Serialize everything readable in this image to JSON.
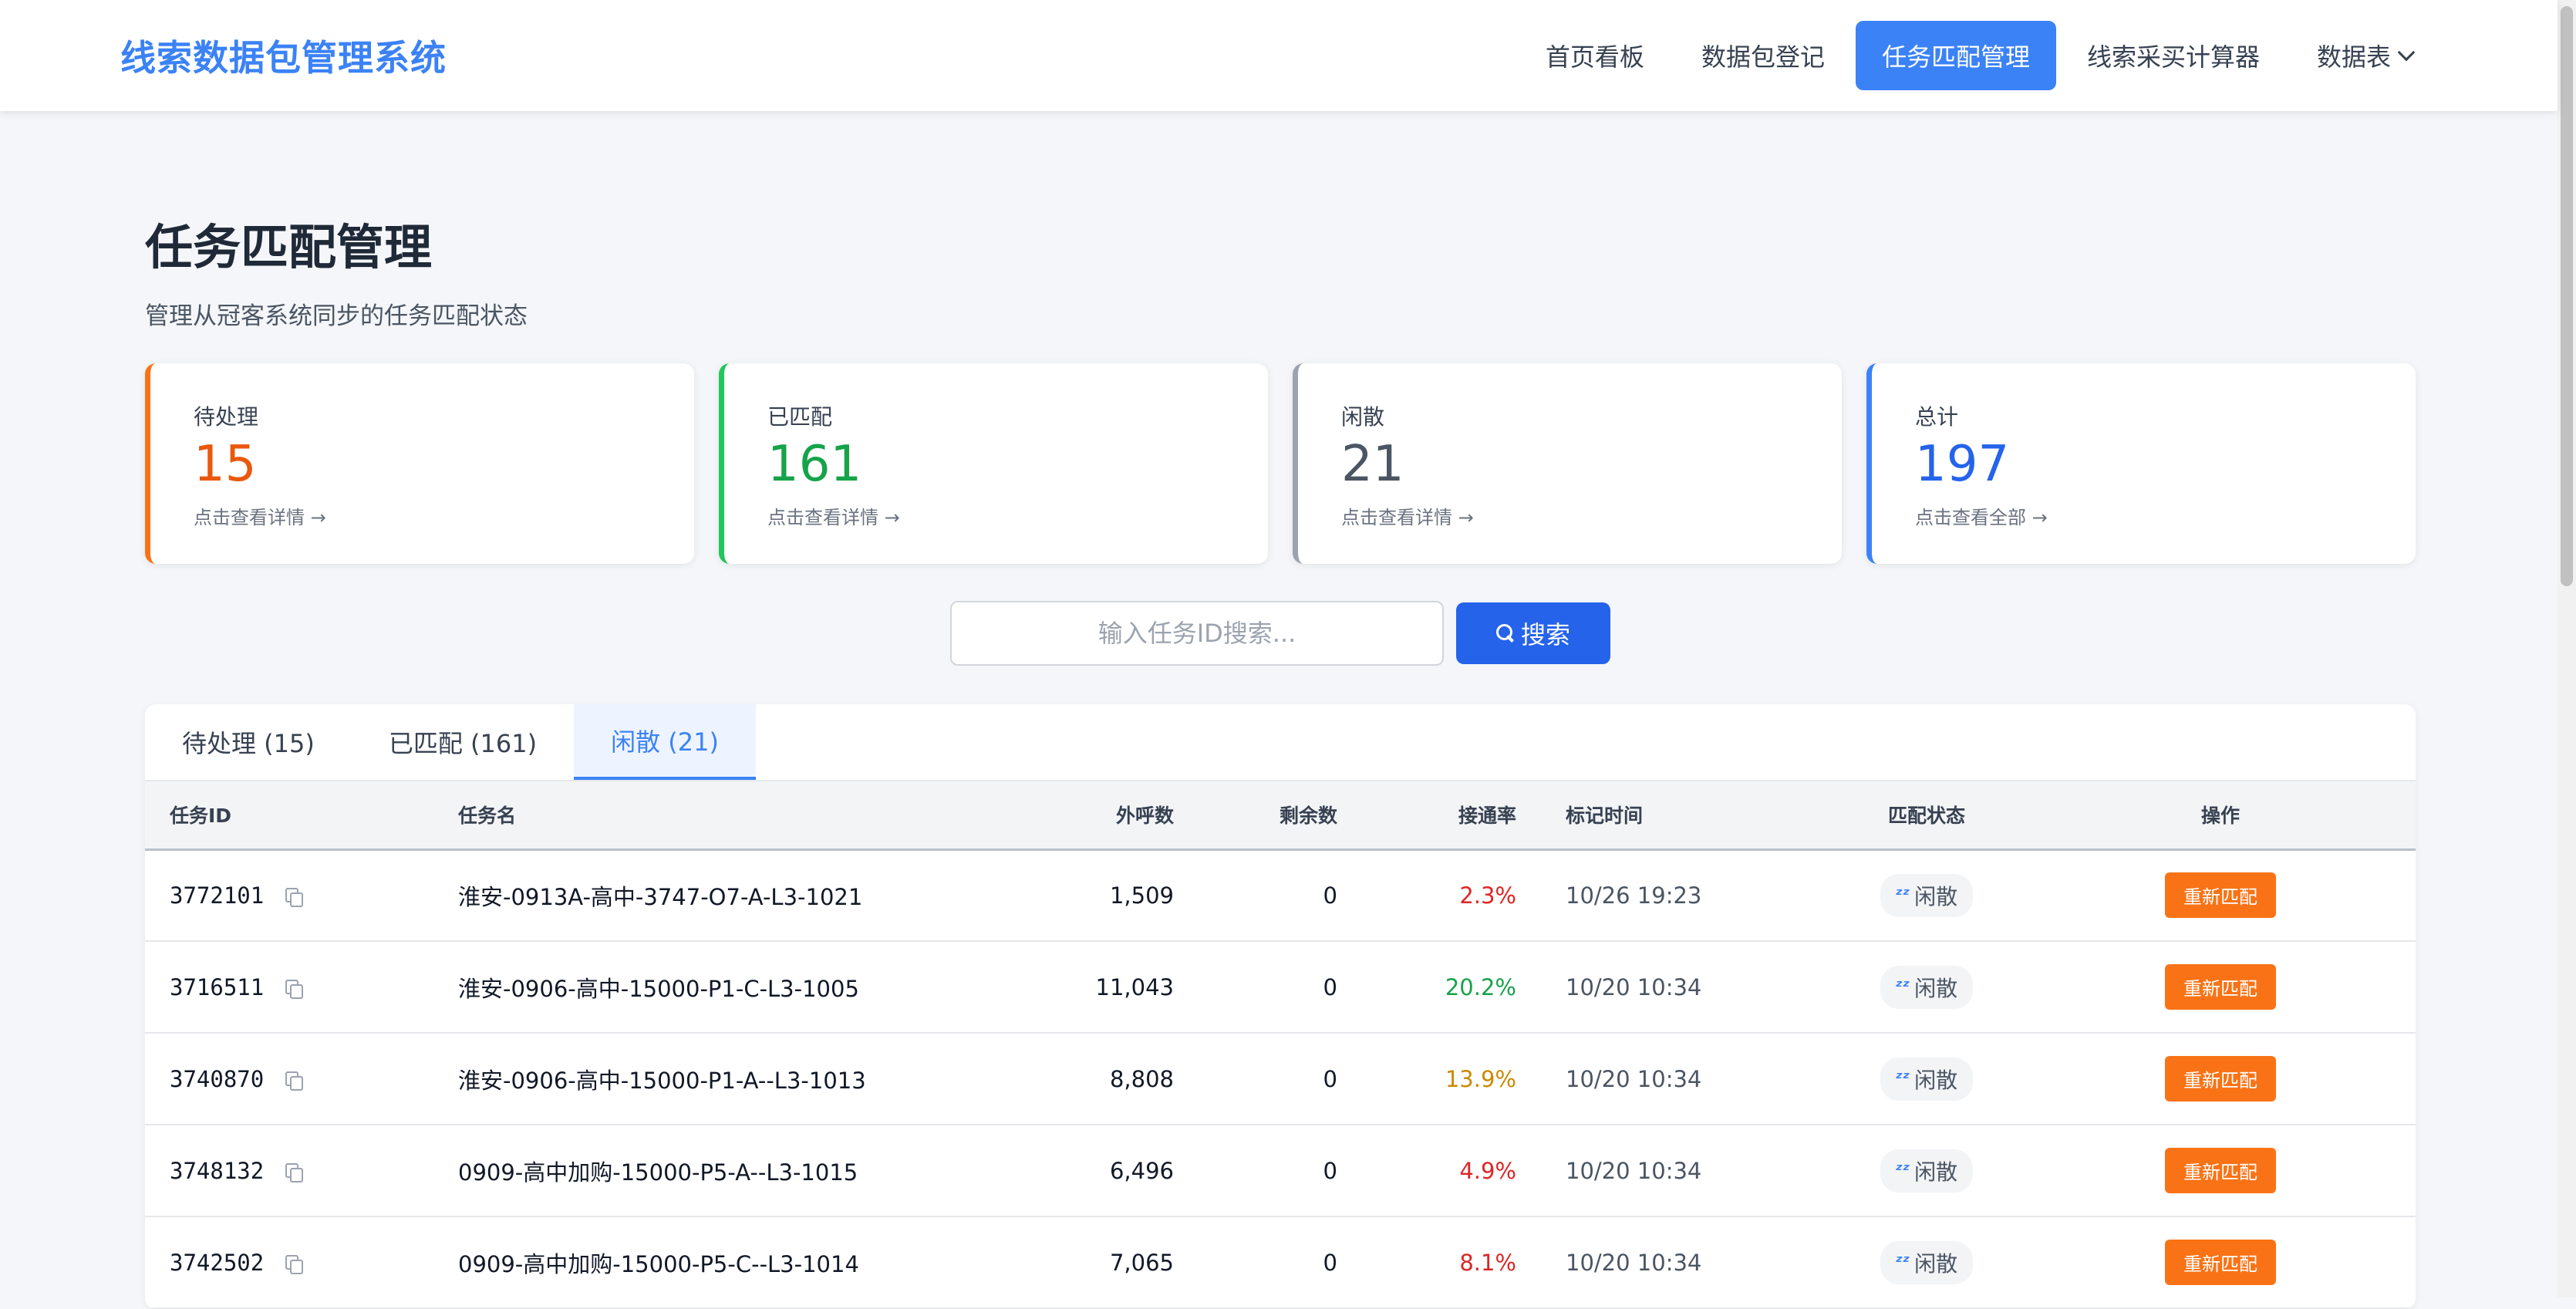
{
  "brand": "线索数据包管理系统",
  "nav": {
    "items": [
      {
        "label": "首页看板",
        "active": false
      },
      {
        "label": "数据包登记",
        "active": false
      },
      {
        "label": "任务匹配管理",
        "active": true
      },
      {
        "label": "线索采买计算器",
        "active": false
      },
      {
        "label": "数据表",
        "active": false
      }
    ]
  },
  "page": {
    "title": "任务匹配管理",
    "subtitle": "管理从冠客系统同步的任务匹配状态"
  },
  "cards": [
    {
      "label": "待处理",
      "value": "15",
      "link": "点击查看详情 →",
      "color": "#ea580c"
    },
    {
      "label": "已匹配",
      "value": "161",
      "link": "点击查看详情 →",
      "color": "#16a34a"
    },
    {
      "label": "闲散",
      "value": "21",
      "link": "点击查看详情 →",
      "color": "#4b5563"
    },
    {
      "label": "总计",
      "value": "197",
      "link": "点击查看全部 →",
      "color": "#2563eb"
    }
  ],
  "search": {
    "placeholder": "输入任务ID搜索...",
    "button_label": "搜索"
  },
  "tabs": [
    {
      "label": "待处理 (15)",
      "active": false
    },
    {
      "label": "已匹配 (161)",
      "active": false
    },
    {
      "label": "闲散 (21)",
      "active": true
    }
  ],
  "table": {
    "headers": {
      "task_id": "任务ID",
      "task_name": "任务名",
      "outbound": "外呼数",
      "remaining": "剩余数",
      "connect_rate": "接通率",
      "mark_time": "标记时间",
      "match_status": "匹配状态",
      "action": "操作"
    },
    "rows": [
      {
        "task_id": "3772101",
        "task_name": "淮安-0913A-高中-3747-O7-A-L3-1021",
        "outbound": "1,509",
        "remaining": "0",
        "connect_rate": "2.3%",
        "rate_color": "#dc2626",
        "mark_time": "10/26 19:23",
        "status": "闲散",
        "action": "重新匹配"
      },
      {
        "task_id": "3716511",
        "task_name": "淮安-0906-高中-15000-P1-C-L3-1005",
        "outbound": "11,043",
        "remaining": "0",
        "connect_rate": "20.2%",
        "rate_color": "#16a34a",
        "mark_time": "10/20 10:34",
        "status": "闲散",
        "action": "重新匹配"
      },
      {
        "task_id": "3740870",
        "task_name": "淮安-0906-高中-15000-P1-A--L3-1013",
        "outbound": "8,808",
        "remaining": "0",
        "connect_rate": "13.9%",
        "rate_color": "#ca8a04",
        "mark_time": "10/20 10:34",
        "status": "闲散",
        "action": "重新匹配"
      },
      {
        "task_id": "3748132",
        "task_name": "0909-高中加购-15000-P5-A--L3-1015",
        "outbound": "6,496",
        "remaining": "0",
        "connect_rate": "4.9%",
        "rate_color": "#dc2626",
        "mark_time": "10/20 10:34",
        "status": "闲散",
        "action": "重新匹配"
      },
      {
        "task_id": "3742502",
        "task_name": "0909-高中加购-15000-P5-C--L3-1014",
        "outbound": "7,065",
        "remaining": "0",
        "connect_rate": "8.1%",
        "rate_color": "#dc2626",
        "mark_time": "10/20 10:34",
        "status": "闲散",
        "action": "重新匹配"
      }
    ]
  },
  "icons": {
    "copy": "copy-icon",
    "status": "sleep-icon",
    "search": "magnifier-icon",
    "dropdown": "chevron-down-icon"
  }
}
